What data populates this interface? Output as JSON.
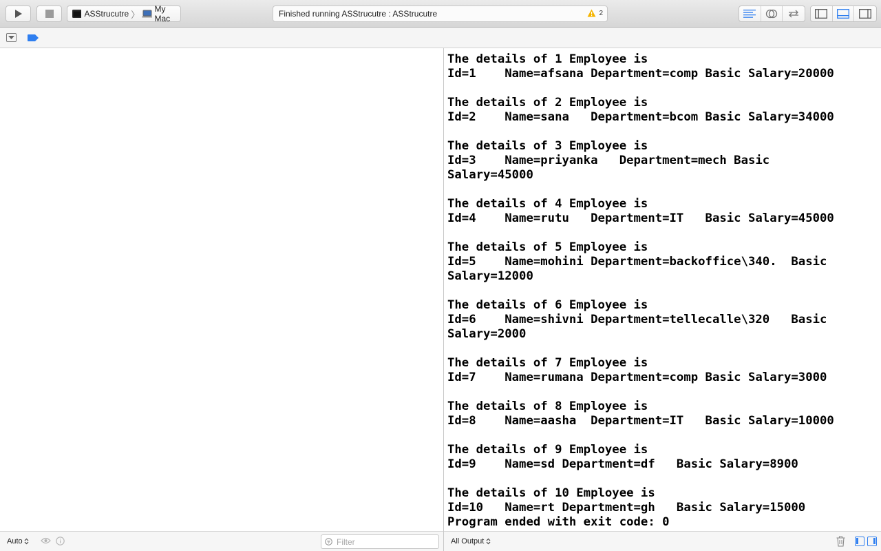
{
  "toolbar": {
    "scheme": {
      "project": "ASStrucutre",
      "separator": "〉",
      "destination": "My Mac"
    },
    "status": {
      "text": "Finished running ASStrucutre : ASStrucutre",
      "warning_count": "2"
    }
  },
  "console": {
    "lines": [
      "The details of 1 Employee is",
      "Id=1    Name=afsana Department=comp Basic Salary=20000",
      "",
      "The details of 2 Employee is",
      "Id=2    Name=sana   Department=bcom Basic Salary=34000",
      "",
      "The details of 3 Employee is",
      "Id=3    Name=priyanka   Department=mech Basic",
      "Salary=45000",
      "",
      "The details of 4 Employee is",
      "Id=4    Name=rutu   Department=IT   Basic Salary=45000",
      "",
      "The details of 5 Employee is",
      "Id=5    Name=mohini Department=backoffice\\340.  Basic",
      "Salary=12000",
      "",
      "The details of 6 Employee is",
      "Id=6    Name=shivni Department=tellecalle\\320   Basic",
      "Salary=2000",
      "",
      "The details of 7 Employee is",
      "Id=7    Name=rumana Department=comp Basic Salary=3000",
      "",
      "The details of 8 Employee is",
      "Id=8    Name=aasha  Department=IT   Basic Salary=10000",
      "",
      "The details of 9 Employee is",
      "Id=9    Name=sd Department=df   Basic Salary=8900",
      "",
      "The details of 10 Employee is",
      "Id=10   Name=rt Department=gh   Basic Salary=15000",
      "Program ended with exit code: 0"
    ]
  },
  "variables_bar": {
    "scope_select": "Auto",
    "filter_placeholder": "Filter"
  },
  "console_bar": {
    "output_select": "All Output"
  },
  "colors": {
    "accent": "#2f7ff0",
    "warning": "#f5b400"
  }
}
